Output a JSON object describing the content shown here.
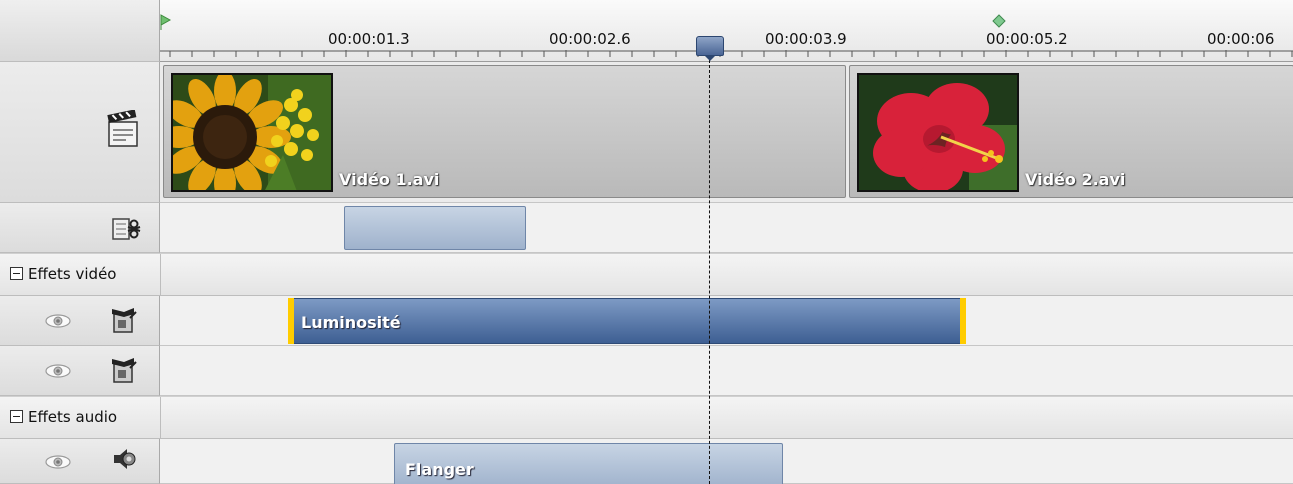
{
  "ruler": {
    "labels": [
      "00:00:01.3",
      "00:00:02.6",
      "00:00:03.9",
      "00:00:05.2",
      "00:00:06"
    ]
  },
  "video_track": {
    "clips": [
      {
        "name": "Vidéo 1.avi",
        "thumbnail": "sunflower"
      },
      {
        "name": "Vidéo 2.avi",
        "thumbnail": "red-hibiscus"
      }
    ]
  },
  "groups": {
    "video_effects": "Effets vidéo",
    "audio_effects": "Effets audio"
  },
  "video_effects": {
    "bars": [
      {
        "label": "Luminosité"
      }
    ]
  },
  "audio_effects": {
    "bars": [
      {
        "label": "Flanger"
      }
    ]
  },
  "colors": {
    "effect_bar": "#4b6a9c",
    "effect_bar_light": "#aebfd6",
    "edge_marker": "#ffcc00",
    "playhead": "#5b75a3"
  },
  "icons": {
    "video_track": "clapperboard-icon",
    "audio_track": "scissors-film-icon",
    "visibility": "eye-icon",
    "video_effect": "effect-wand-icon",
    "audio_effect": "speaker-effect-icon"
  }
}
